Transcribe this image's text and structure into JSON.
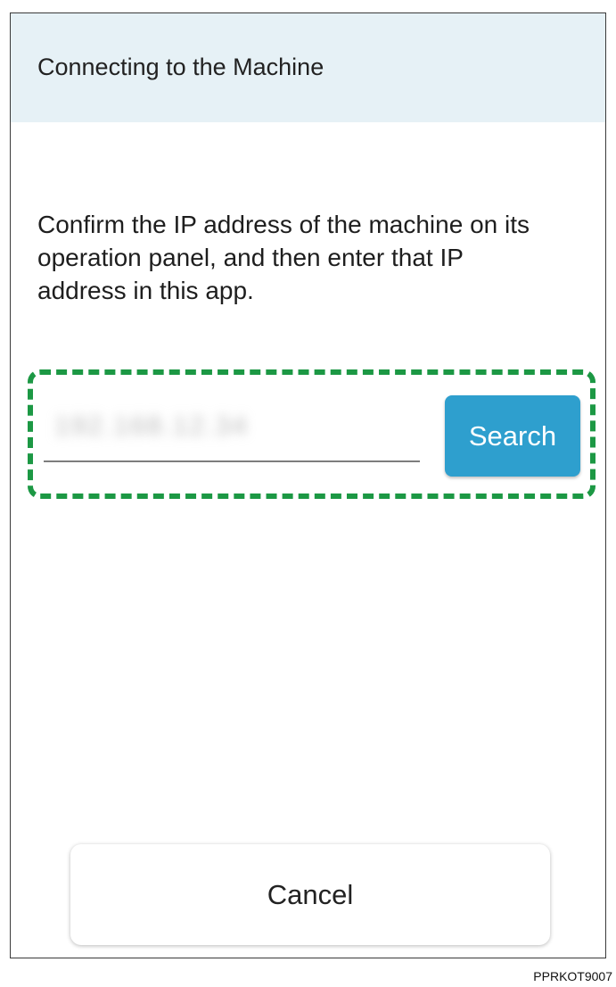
{
  "header": {
    "title": "Connecting to the Machine"
  },
  "instruction": {
    "text": "Confirm the IP address of the machine on its operation panel, and then enter that IP address in this app."
  },
  "ip_input": {
    "value": "192.168.12.34"
  },
  "buttons": {
    "search_label": "Search",
    "cancel_label": "Cancel"
  },
  "footer": {
    "doc_code": "PPRKOT9007"
  },
  "colors": {
    "header_bg": "#e6f1f6",
    "search_button": "#2e9fce",
    "highlight_dashes": "#1c9844"
  }
}
